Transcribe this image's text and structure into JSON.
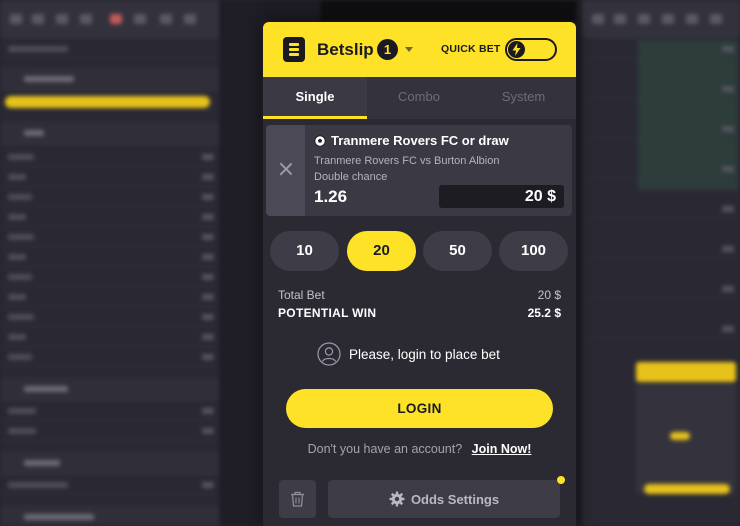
{
  "colors": {
    "accent_yellow": "#fde228",
    "panel_bg": "#2b2a33",
    "card_bg": "#3a3944",
    "dark": "#1b1a20"
  },
  "betslip": {
    "title": "Betslip",
    "count": "1",
    "quick_bet_label": "QUICK BET",
    "quick_bet_on": false
  },
  "tabs": [
    {
      "label": "Single",
      "active": true
    },
    {
      "label": "Combo",
      "active": false
    },
    {
      "label": "System",
      "active": false
    }
  ],
  "bet": {
    "selection": "Tranmere Rovers FC or draw",
    "match": "Tranmere Rovers FC vs Burton Albion",
    "market": "Double chance",
    "odds": "1.26",
    "stake": "20 $"
  },
  "quick_stakes": [
    {
      "label": "10",
      "active": false
    },
    {
      "label": "20",
      "active": true
    },
    {
      "label": "50",
      "active": false
    },
    {
      "label": "100",
      "active": false
    }
  ],
  "summary": {
    "total_bet_label": "Total Bet",
    "total_bet_value": "20 $",
    "potential_win_label": "POTENTIAL WIN",
    "potential_win_value": "25.2 $"
  },
  "login_prompt": "Please, login to place bet",
  "login_button": "LOGIN",
  "signup": {
    "question": "Don't you have an account?",
    "link": "Join Now!"
  },
  "odds_settings_label": "Odds Settings"
}
